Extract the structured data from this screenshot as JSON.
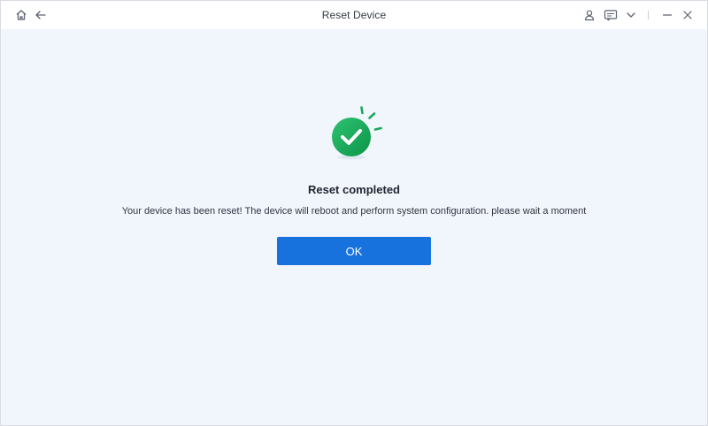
{
  "window": {
    "title": "Reset Device",
    "toolbar_icons": [
      "home-icon",
      "back-arrow-icon",
      "user-icon",
      "feedback-icon",
      "chevron-down-icon",
      "minimize-icon",
      "close-icon"
    ]
  },
  "result": {
    "icon": "check-circle-icon",
    "title": "Reset completed",
    "description": "Your device has been reset! The device will reboot and perform system configuration. please wait a moment",
    "ok_label": "OK"
  },
  "colors": {
    "accent_blue": "#1872dd",
    "success_green": "#17a558",
    "background": "#f1f5fc",
    "titlebar": "#ffffff"
  }
}
